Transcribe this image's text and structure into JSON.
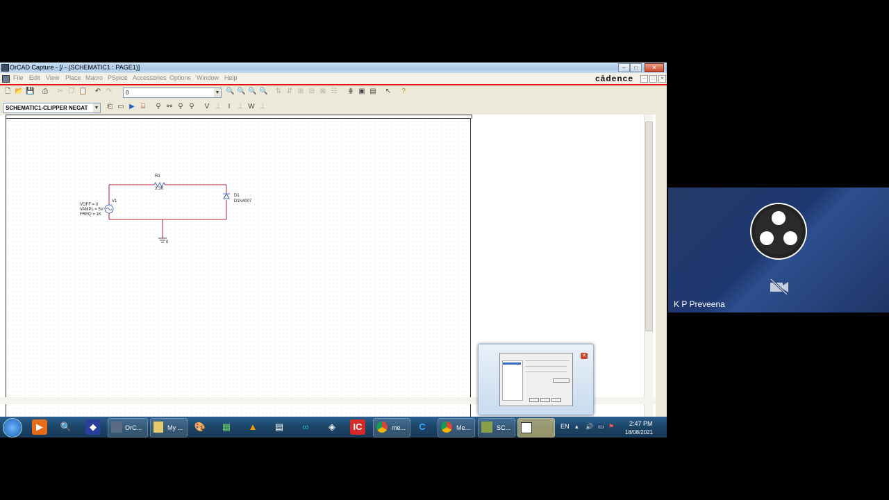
{
  "window": {
    "title": "OrCAD Capture - [/ - (SCHEMATIC1 : PAGE1)]",
    "brand": "cādence"
  },
  "menu": [
    "File",
    "Edit",
    "View",
    "Place",
    "Macro",
    "PSpice",
    "Accessories",
    "Options",
    "Window",
    "Help"
  ],
  "toolbar": {
    "part_combo_value": "0",
    "schematic_combo_value": "SCHEMATIC1-CLIPPER NEGAT"
  },
  "schematic": {
    "resistor": {
      "ref": "R1",
      "value": "3.3K"
    },
    "diode": {
      "ref": "D1",
      "value": "D1N4007"
    },
    "source": {
      "ref": "V1",
      "params": [
        "VOFF = 0",
        "VAMPL = 5V",
        "FREQ = 1K"
      ]
    },
    "ground_label": "0",
    "wire_color": "#b3243a"
  },
  "taskbar": {
    "buttons": [
      {
        "label": "OrC..."
      },
      {
        "label": "My ..."
      },
      {
        "label": "me..."
      },
      {
        "label": "Me..."
      },
      {
        "label": "SC..."
      }
    ],
    "lang": "EN",
    "time": "2:47 PM",
    "date": "18/08/2021"
  },
  "video": {
    "participant_name": "K P Preveena"
  },
  "colors": {
    "accent_red": "#e01010",
    "taskbar": "#1c4466",
    "video_bg": "#1e3870"
  }
}
